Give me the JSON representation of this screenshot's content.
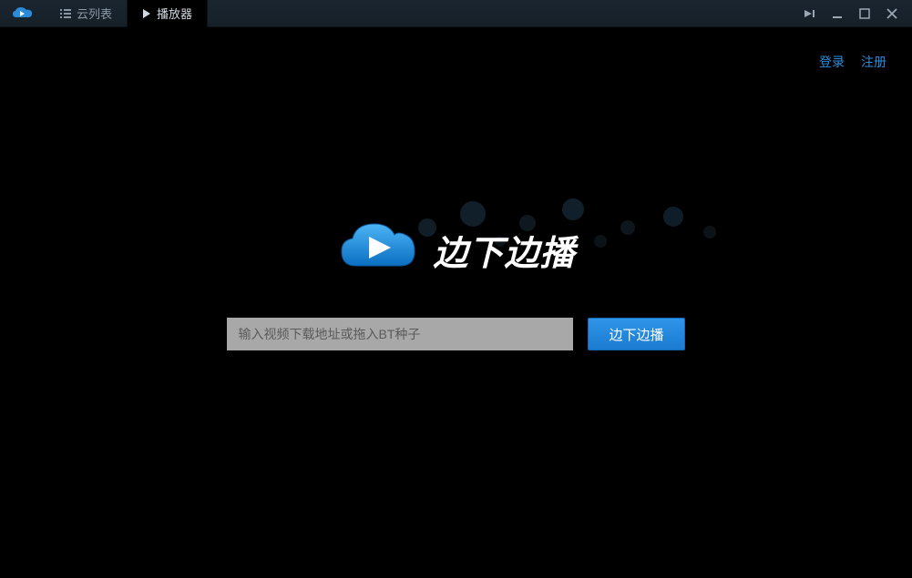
{
  "titlebar": {
    "tabs": [
      {
        "label": "云列表"
      },
      {
        "label": "播放器"
      }
    ]
  },
  "topLinks": {
    "login": "登录",
    "register": "注册"
  },
  "brand": {
    "name": "边下边播"
  },
  "main": {
    "input_placeholder": "输入视频下载地址或拖入BT种子",
    "button_label": "边下边播"
  }
}
